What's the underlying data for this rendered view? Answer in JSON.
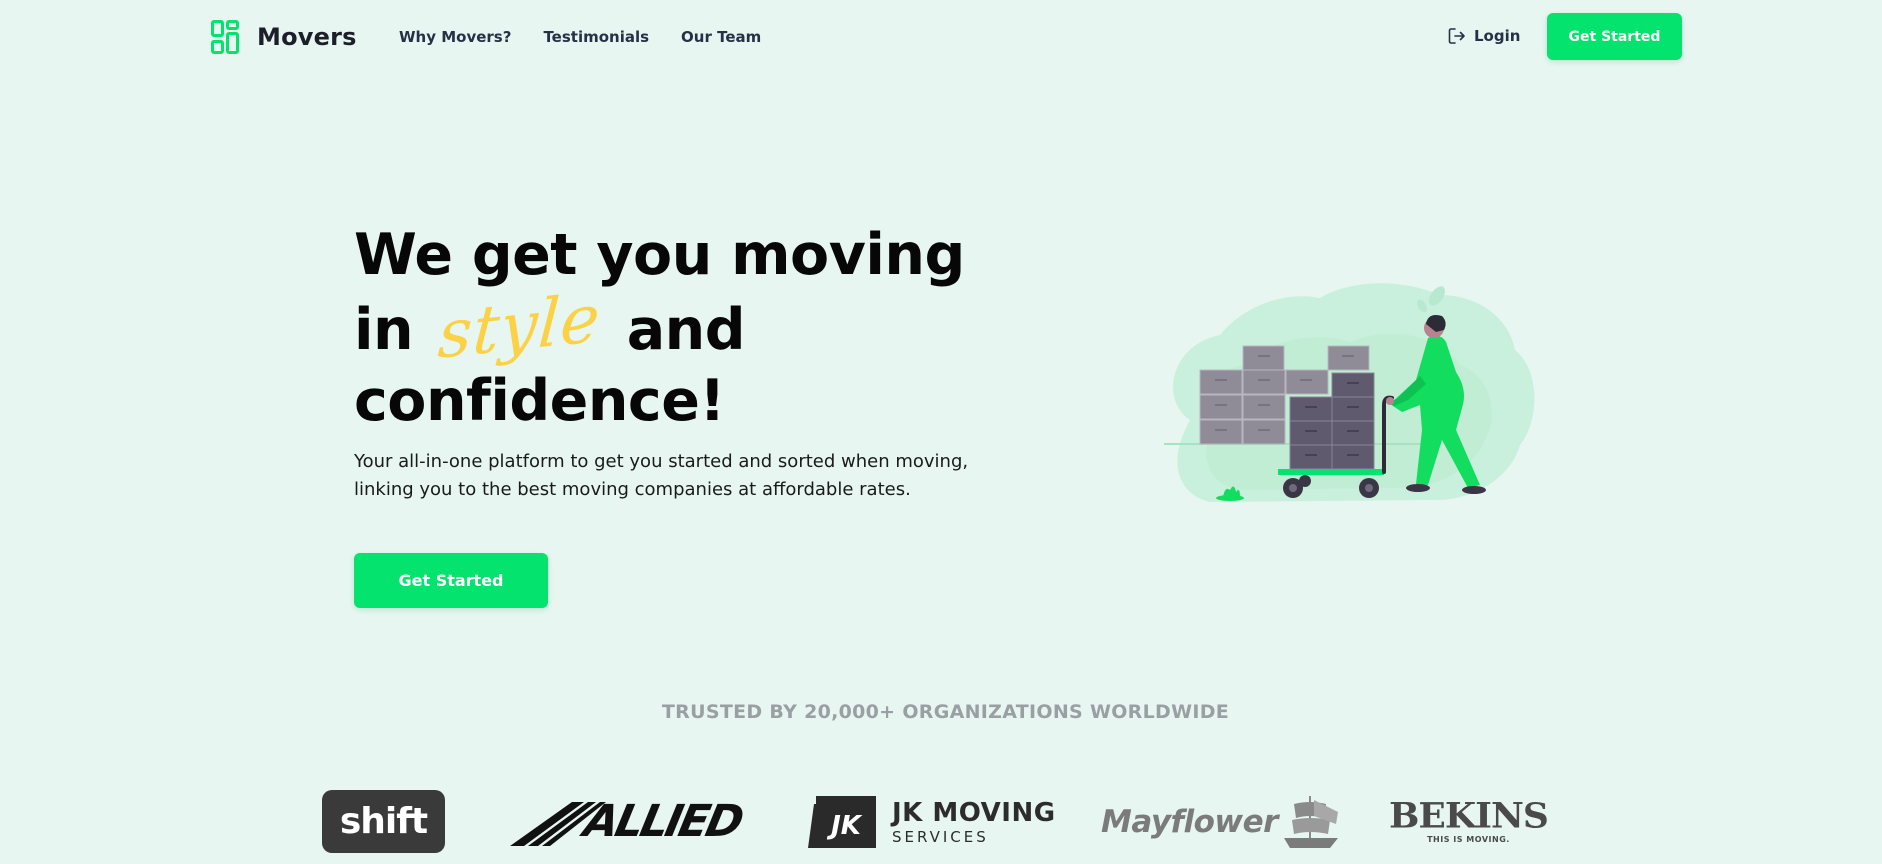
{
  "nav": {
    "brand_name": "Movers",
    "links": [
      "Why Movers?",
      "Testimonials",
      "Our Team"
    ],
    "login_label": "Login",
    "cta_label": "Get Started"
  },
  "hero": {
    "title_line1": "We get you moving",
    "title_in": "in",
    "title_accent": "style",
    "title_and": "and",
    "title_line3": "confidence!",
    "subtitle_line1": "Your all-in-one platform to get you started and sorted when moving,",
    "subtitle_line2": "linking you to the best moving companies at affordable rates.",
    "cta_label": "Get Started"
  },
  "trusted": {
    "heading": "TRUSTED BY 20,000+ ORGANIZATIONS WORLDWIDE",
    "logos": {
      "shift": "shift",
      "allied": "ALLIED",
      "jk_initials": "JK",
      "jk_top": "JK MOVING",
      "jk_bottom": "SERVICES",
      "mayflower": "Mayflower",
      "bekins": "BEKINS",
      "bekins_tag": "THIS IS MOVING."
    }
  },
  "colors": {
    "background": "#e7f6f1",
    "accent_green": "#04e36d",
    "accent_yellow": "#fbd246",
    "text_dark": "#070707",
    "muted_gray": "#9a9fa3"
  },
  "icons": {
    "brand": "grid-logo-icon",
    "login": "login-arrow-icon",
    "illustration": "mover-pushing-cart-illustration"
  }
}
